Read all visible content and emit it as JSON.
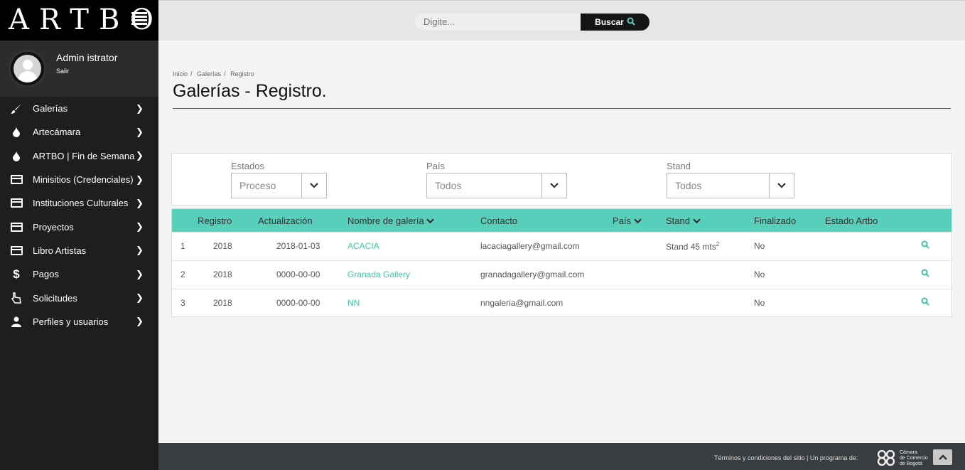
{
  "app": {
    "logo_text": "ARTBO",
    "user_name": "Admin istrator",
    "logout_label": "Salir"
  },
  "sidebar": {
    "items": [
      {
        "label": "Galerías",
        "icon": "brush-icon"
      },
      {
        "label": "Artecámara",
        "icon": "drop-icon"
      },
      {
        "label": "ARTBO | Fin de Semana",
        "icon": "drop-icon"
      },
      {
        "label": "Minisitios (Credenciales)",
        "icon": "credit-card-icon"
      },
      {
        "label": "Instituciones Culturales",
        "icon": "credit-card-icon"
      },
      {
        "label": "Proyectos",
        "icon": "credit-card-icon"
      },
      {
        "label": "Libro Artistas",
        "icon": "credit-card-icon"
      },
      {
        "label": "Pagos",
        "icon": "dollar-icon"
      },
      {
        "label": "Solicitudes",
        "icon": "hand-pointer-icon"
      },
      {
        "label": "Perfiles y usuarios",
        "icon": "user-icon"
      }
    ]
  },
  "search": {
    "placeholder": "Digite...",
    "button_label": "Buscar"
  },
  "breadcrumb": [
    "Inicio",
    "Galerías",
    "Registro"
  ],
  "page_title": "Galerías - Registro.",
  "filters": {
    "estados": {
      "label": "Estados",
      "value": "Proceso"
    },
    "pais": {
      "label": "País",
      "value": "Todos"
    },
    "stand": {
      "label": "Stand",
      "value": "Todos"
    }
  },
  "table": {
    "headers": {
      "registro": "Registro",
      "actualizacion": "Actualización",
      "nombre": "Nombre de galería",
      "contacto": "Contacto",
      "pais": "País",
      "stand": "Stand",
      "finalizado": "Finalizado",
      "estado": "Estado Artbo"
    },
    "rows": [
      {
        "num": "1",
        "registro": "2018",
        "actualizacion": "2018-01-03",
        "nombre": "ACACIA",
        "contacto": "lacaciagallery@gmail.com",
        "stand": "Stand 45 mts",
        "stand_sup": "2",
        "finalizado": "No"
      },
      {
        "num": "2",
        "registro": "2018",
        "actualizacion": "0000-00-00",
        "nombre": "Granada Gallery",
        "contacto": "granadagallery@gmail.com",
        "stand": "",
        "stand_sup": "",
        "finalizado": "No"
      },
      {
        "num": "3",
        "registro": "2018",
        "actualizacion": "0000-00-00",
        "nombre": "NN",
        "contacto": "nngaleria@gmail.com",
        "stand": "",
        "stand_sup": "",
        "finalizado": "No"
      }
    ]
  },
  "footer": {
    "text": "Términos y condiciones del sitio | Un programa de:",
    "org_lines": [
      "Cámara",
      "de Comercio",
      "de Bogotá"
    ]
  },
  "colors": {
    "accent": "#57cfba",
    "link": "#45c3ab",
    "sidebar_bg": "#1d1e1f"
  }
}
